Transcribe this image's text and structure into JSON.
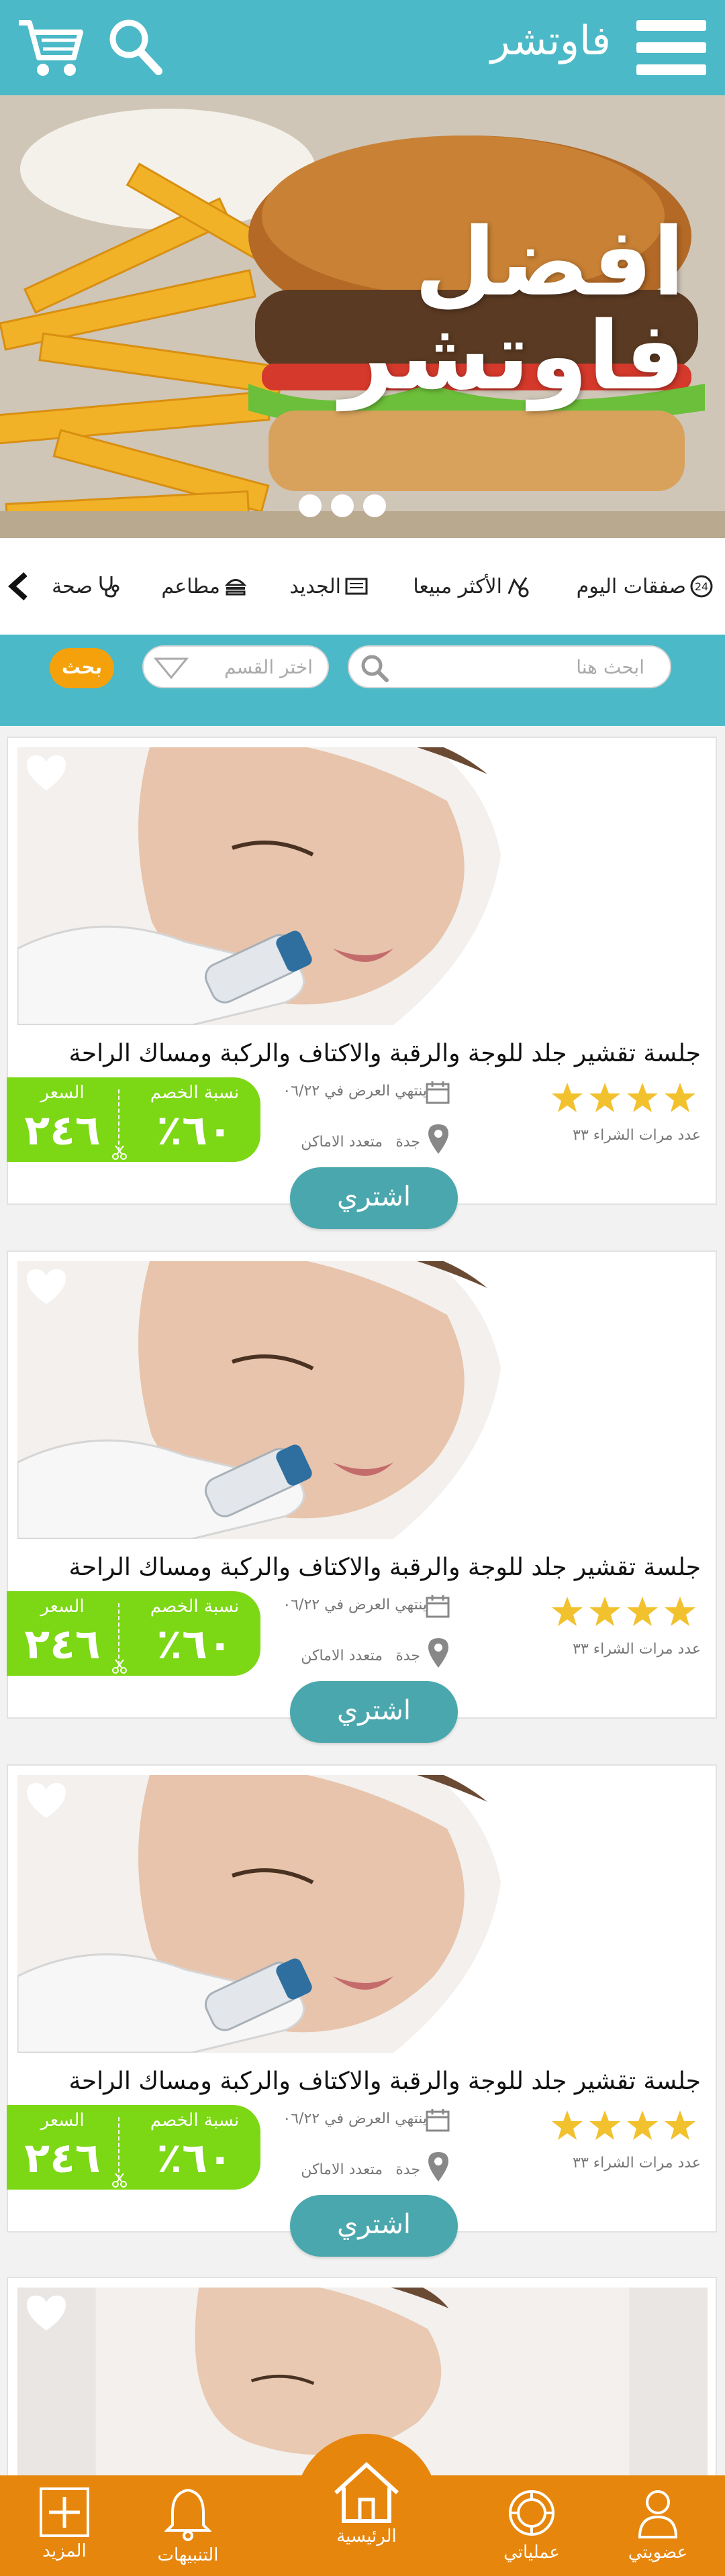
{
  "header": {
    "title": "فاوتشر",
    "menu_icon": "hamburger-menu-icon",
    "cart_icon": "shopping-cart-icon",
    "search_icon": "search-icon"
  },
  "hero": {
    "title": "افضل فاوتشر",
    "slide_count": 3
  },
  "categories": {
    "items": [
      {
        "label": "صفقات اليوم",
        "icon": "deals-icon"
      },
      {
        "label": "الأكثر مبيعا",
        "icon": "bestseller-icon"
      },
      {
        "label": "الجديد",
        "icon": "newspaper-icon"
      },
      {
        "label": "مطاعم",
        "icon": "burger-icon"
      },
      {
        "label": "صحة",
        "icon": "stethoscope-icon"
      }
    ]
  },
  "search": {
    "placeholder": "ابحث هنا",
    "category_placeholder": "اختر القسم",
    "button_label": "بحث"
  },
  "offers": [
    {
      "title": "جلسة تقشير جلد للوجة  والرقبة والاكتاف والركبة ومساك الراحة",
      "rating": 4,
      "purchases_label": "عدد مرات الشراء ٣٣",
      "ends_label": "ينتهي العرض في ٠٦/٢٢",
      "location_label": "جدة",
      "multi_location_label": "متعدد الاماكن",
      "discount_label": "نسبة الخصم",
      "discount_value": "٦٠٪",
      "price_label": "السعر",
      "price_value": "٢٤٦",
      "buy_label": "اشتري"
    },
    {
      "title": "جلسة تقشير جلد للوجة  والرقبة والاكتاف والركبة ومساك الراحة",
      "rating": 4,
      "purchases_label": "عدد مرات الشراء ٣٣",
      "ends_label": "ينتهي العرض في ٠٦/٢٢",
      "location_label": "جدة",
      "multi_location_label": "متعدد الاماكن",
      "discount_label": "نسبة الخصم",
      "discount_value": "٦٠٪",
      "price_label": "السعر",
      "price_value": "٢٤٦",
      "buy_label": "اشتري"
    },
    {
      "title": "جلسة تقشير جلد للوجة  والرقبة والاكتاف والركبة ومساك الراحة",
      "rating": 4,
      "purchases_label": "عدد مرات الشراء ٣٣",
      "ends_label": "ينتهي العرض في ٠٦/٢٢",
      "location_label": "جدة",
      "multi_location_label": "متعدد الاماكن",
      "discount_label": "نسبة الخصم",
      "discount_value": "٦٠٪",
      "price_label": "السعر",
      "price_value": "٢٤٦",
      "buy_label": "اشتري"
    }
  ],
  "bottom_nav": {
    "items": [
      {
        "label": "عضويتي",
        "icon": "user-icon"
      },
      {
        "label": "عملياتي",
        "icon": "operations-icon"
      },
      {
        "label": "الرئيسية",
        "icon": "home-icon"
      },
      {
        "label": "التنبيهات",
        "icon": "bell-icon"
      },
      {
        "label": "المزيد",
        "icon": "plus-box-icon"
      }
    ]
  },
  "colors": {
    "primary": "#4bb9c7",
    "accent": "#f5a10b",
    "nav": "#e6860d",
    "price_green": "#7cd714",
    "buy_button": "#4aa7ad",
    "star": "#f2c12e"
  }
}
